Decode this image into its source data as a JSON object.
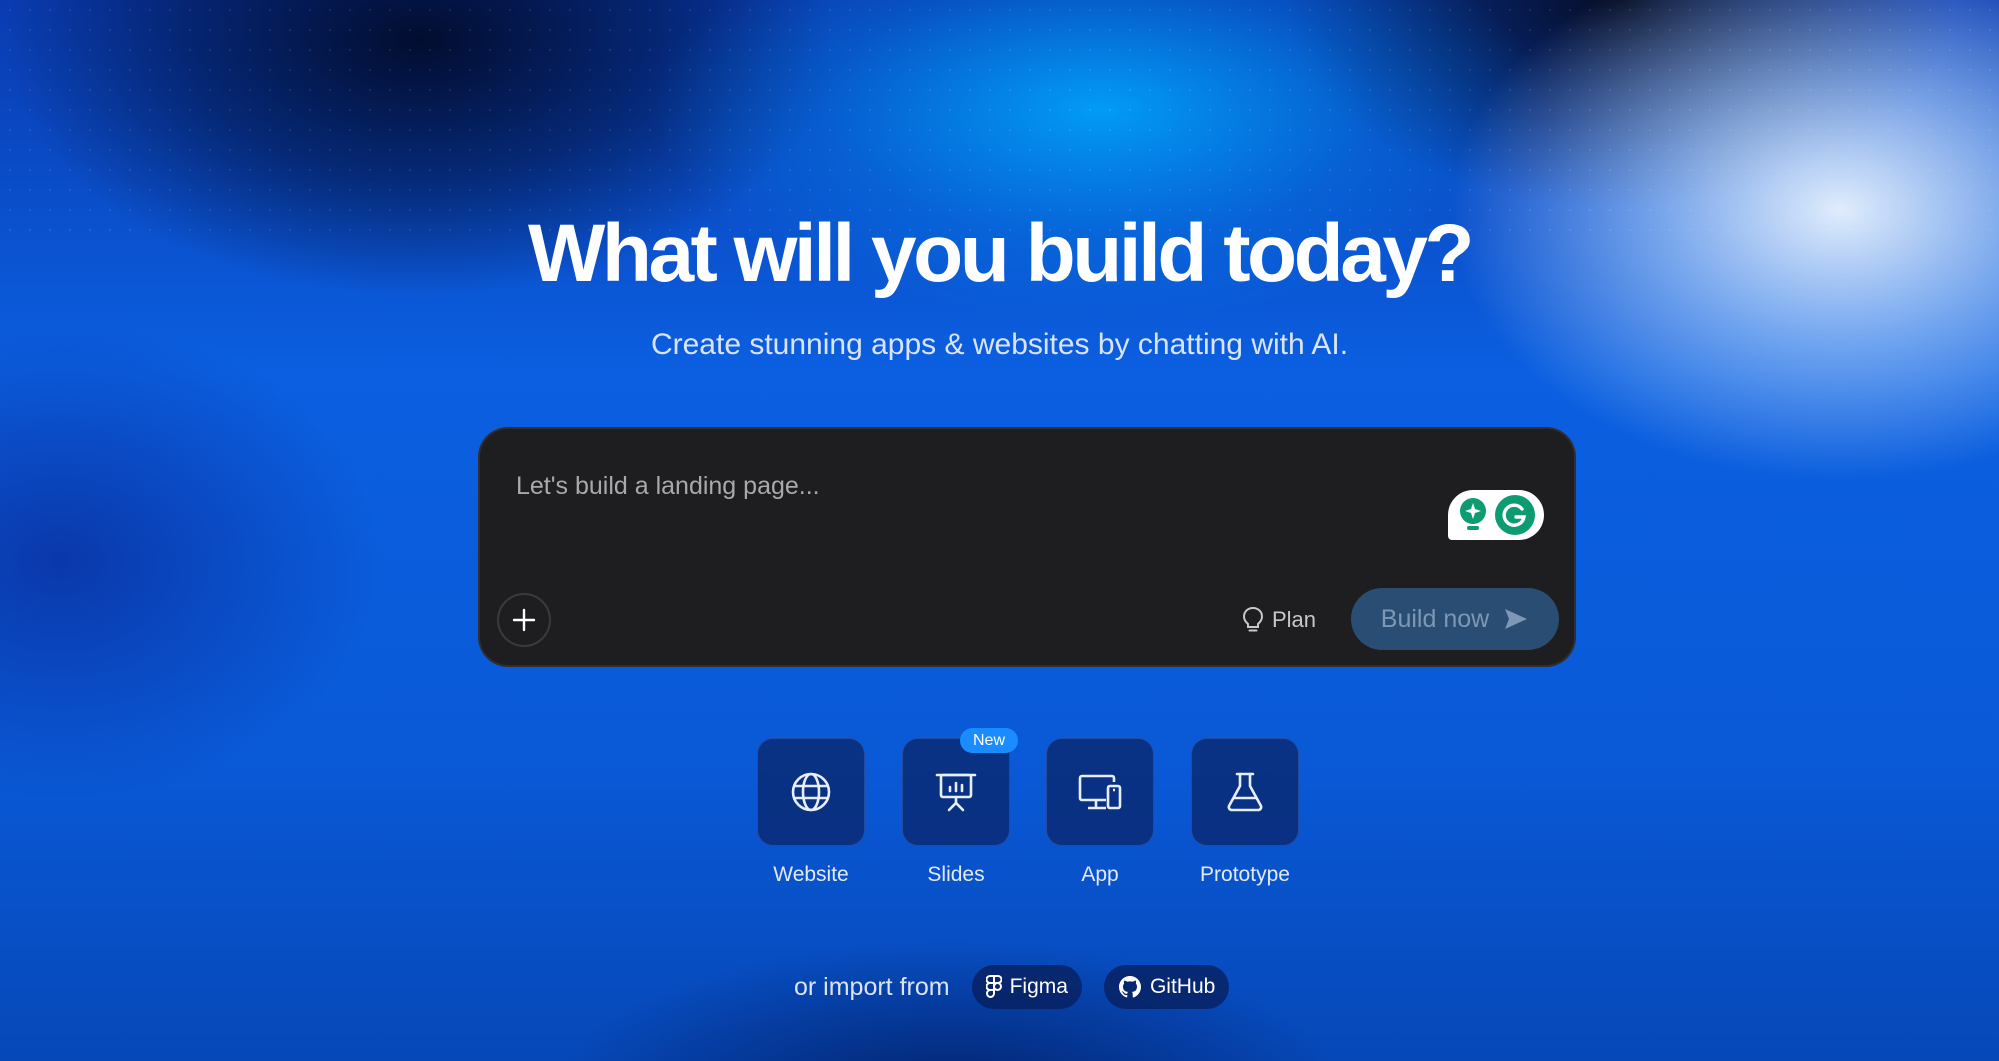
{
  "hero": {
    "title": "What will you build today?",
    "subtitle": "Create stunning apps & websites by chatting with AI."
  },
  "prompt": {
    "placeholder": "Let's build a landing page...",
    "value": "",
    "plan_label": "Plan",
    "build_label": "Build now"
  },
  "project_types": [
    {
      "label": "Website",
      "icon": "globe-icon"
    },
    {
      "label": "Slides",
      "icon": "presentation-icon",
      "badge": "New"
    },
    {
      "label": "App",
      "icon": "devices-icon"
    },
    {
      "label": "Prototype",
      "icon": "flask-icon"
    }
  ],
  "import": {
    "label": "or import from",
    "sources": [
      {
        "label": "Figma",
        "icon": "figma-icon"
      },
      {
        "label": "GitHub",
        "icon": "github-icon"
      }
    ]
  },
  "colors": {
    "background_accent": "#0a56d4",
    "prompt_bg": "#1e1e20",
    "build_button_bg": "#294d73",
    "badge_bg": "#1a8cff",
    "grammarly_green": "#0d9b72"
  }
}
